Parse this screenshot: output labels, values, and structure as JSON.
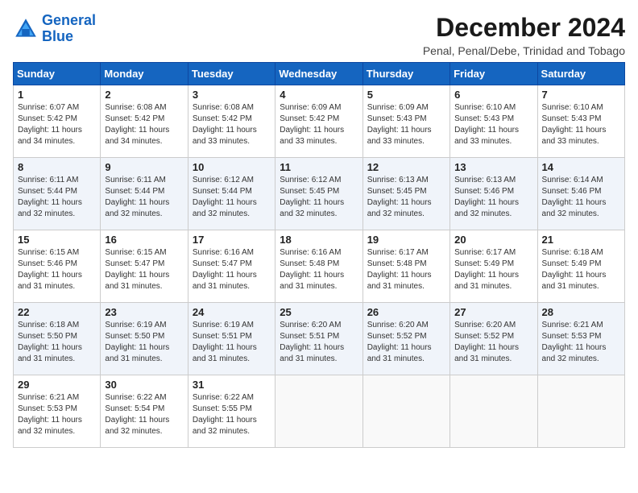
{
  "header": {
    "logo_line1": "General",
    "logo_line2": "Blue",
    "month": "December 2024",
    "location": "Penal, Penal/Debe, Trinidad and Tobago"
  },
  "weekdays": [
    "Sunday",
    "Monday",
    "Tuesday",
    "Wednesday",
    "Thursday",
    "Friday",
    "Saturday"
  ],
  "weeks": [
    [
      {
        "day": "1",
        "info": "Sunrise: 6:07 AM\nSunset: 5:42 PM\nDaylight: 11 hours\nand 34 minutes."
      },
      {
        "day": "2",
        "info": "Sunrise: 6:08 AM\nSunset: 5:42 PM\nDaylight: 11 hours\nand 34 minutes."
      },
      {
        "day": "3",
        "info": "Sunrise: 6:08 AM\nSunset: 5:42 PM\nDaylight: 11 hours\nand 33 minutes."
      },
      {
        "day": "4",
        "info": "Sunrise: 6:09 AM\nSunset: 5:42 PM\nDaylight: 11 hours\nand 33 minutes."
      },
      {
        "day": "5",
        "info": "Sunrise: 6:09 AM\nSunset: 5:43 PM\nDaylight: 11 hours\nand 33 minutes."
      },
      {
        "day": "6",
        "info": "Sunrise: 6:10 AM\nSunset: 5:43 PM\nDaylight: 11 hours\nand 33 minutes."
      },
      {
        "day": "7",
        "info": "Sunrise: 6:10 AM\nSunset: 5:43 PM\nDaylight: 11 hours\nand 33 minutes."
      }
    ],
    [
      {
        "day": "8",
        "info": "Sunrise: 6:11 AM\nSunset: 5:44 PM\nDaylight: 11 hours\nand 32 minutes."
      },
      {
        "day": "9",
        "info": "Sunrise: 6:11 AM\nSunset: 5:44 PM\nDaylight: 11 hours\nand 32 minutes."
      },
      {
        "day": "10",
        "info": "Sunrise: 6:12 AM\nSunset: 5:44 PM\nDaylight: 11 hours\nand 32 minutes."
      },
      {
        "day": "11",
        "info": "Sunrise: 6:12 AM\nSunset: 5:45 PM\nDaylight: 11 hours\nand 32 minutes."
      },
      {
        "day": "12",
        "info": "Sunrise: 6:13 AM\nSunset: 5:45 PM\nDaylight: 11 hours\nand 32 minutes."
      },
      {
        "day": "13",
        "info": "Sunrise: 6:13 AM\nSunset: 5:46 PM\nDaylight: 11 hours\nand 32 minutes."
      },
      {
        "day": "14",
        "info": "Sunrise: 6:14 AM\nSunset: 5:46 PM\nDaylight: 11 hours\nand 32 minutes."
      }
    ],
    [
      {
        "day": "15",
        "info": "Sunrise: 6:15 AM\nSunset: 5:46 PM\nDaylight: 11 hours\nand 31 minutes."
      },
      {
        "day": "16",
        "info": "Sunrise: 6:15 AM\nSunset: 5:47 PM\nDaylight: 11 hours\nand 31 minutes."
      },
      {
        "day": "17",
        "info": "Sunrise: 6:16 AM\nSunset: 5:47 PM\nDaylight: 11 hours\nand 31 minutes."
      },
      {
        "day": "18",
        "info": "Sunrise: 6:16 AM\nSunset: 5:48 PM\nDaylight: 11 hours\nand 31 minutes."
      },
      {
        "day": "19",
        "info": "Sunrise: 6:17 AM\nSunset: 5:48 PM\nDaylight: 11 hours\nand 31 minutes."
      },
      {
        "day": "20",
        "info": "Sunrise: 6:17 AM\nSunset: 5:49 PM\nDaylight: 11 hours\nand 31 minutes."
      },
      {
        "day": "21",
        "info": "Sunrise: 6:18 AM\nSunset: 5:49 PM\nDaylight: 11 hours\nand 31 minutes."
      }
    ],
    [
      {
        "day": "22",
        "info": "Sunrise: 6:18 AM\nSunset: 5:50 PM\nDaylight: 11 hours\nand 31 minutes."
      },
      {
        "day": "23",
        "info": "Sunrise: 6:19 AM\nSunset: 5:50 PM\nDaylight: 11 hours\nand 31 minutes."
      },
      {
        "day": "24",
        "info": "Sunrise: 6:19 AM\nSunset: 5:51 PM\nDaylight: 11 hours\nand 31 minutes."
      },
      {
        "day": "25",
        "info": "Sunrise: 6:20 AM\nSunset: 5:51 PM\nDaylight: 11 hours\nand 31 minutes."
      },
      {
        "day": "26",
        "info": "Sunrise: 6:20 AM\nSunset: 5:52 PM\nDaylight: 11 hours\nand 31 minutes."
      },
      {
        "day": "27",
        "info": "Sunrise: 6:20 AM\nSunset: 5:52 PM\nDaylight: 11 hours\nand 31 minutes."
      },
      {
        "day": "28",
        "info": "Sunrise: 6:21 AM\nSunset: 5:53 PM\nDaylight: 11 hours\nand 32 minutes."
      }
    ],
    [
      {
        "day": "29",
        "info": "Sunrise: 6:21 AM\nSunset: 5:53 PM\nDaylight: 11 hours\nand 32 minutes."
      },
      {
        "day": "30",
        "info": "Sunrise: 6:22 AM\nSunset: 5:54 PM\nDaylight: 11 hours\nand 32 minutes."
      },
      {
        "day": "31",
        "info": "Sunrise: 6:22 AM\nSunset: 5:55 PM\nDaylight: 11 hours\nand 32 minutes."
      },
      null,
      null,
      null,
      null
    ]
  ]
}
